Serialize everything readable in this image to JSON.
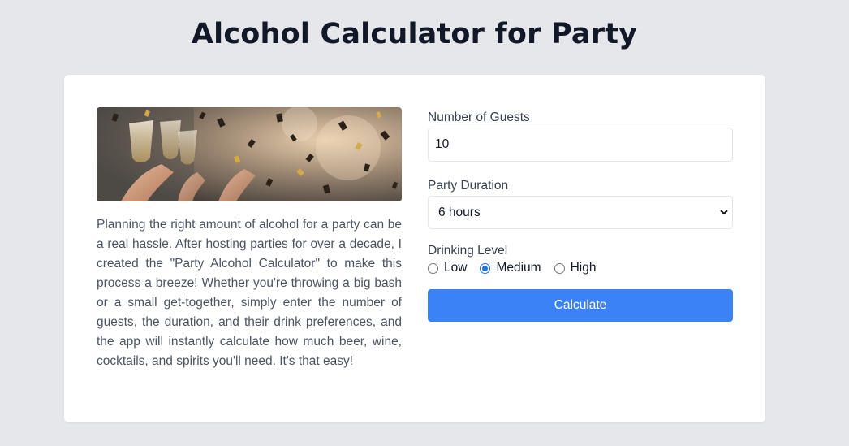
{
  "page": {
    "title": "Alcohol Calculator for Party"
  },
  "intro": {
    "image_alt": "People toasting with champagne glasses among falling confetti",
    "description": "Planning the right amount of alcohol for a party can be a real hassle. After hosting parties for over a decade, I created the \"Party Alcohol Calculator\" to make this process a breeze! Whether you're throwing a big bash or a small get-together, simply enter the number of guests, the duration, and their drink preferences, and the app will instantly calculate how much beer, wine, cocktails, and spirits you'll need. It's that easy!"
  },
  "form": {
    "guests": {
      "label": "Number of Guests",
      "value": "10"
    },
    "duration": {
      "label": "Party Duration",
      "selected": "6 hours"
    },
    "drinking_level": {
      "label": "Drinking Level",
      "options": [
        {
          "label": "Low",
          "checked": false
        },
        {
          "label": "Medium",
          "checked": true
        },
        {
          "label": "High",
          "checked": false
        }
      ]
    },
    "submit_label": "Calculate"
  },
  "colors": {
    "background": "#e5e7eb",
    "card": "#ffffff",
    "button": "#3b82f6",
    "radio_accent": "#1a73e8"
  }
}
